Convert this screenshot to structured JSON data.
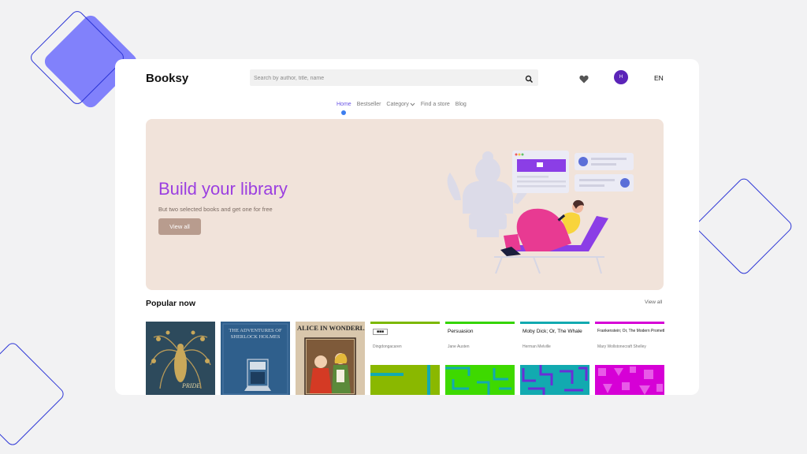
{
  "app": {
    "logo": "Booksy",
    "search_placeholder": "Search by author, title, name",
    "avatar_initial": "H",
    "language": "EN"
  },
  "nav": {
    "items": [
      {
        "label": "Home",
        "active": true
      },
      {
        "label": "Bestseller",
        "active": false
      },
      {
        "label": "Category",
        "active": false,
        "dropdown": true
      },
      {
        "label": "Find a store",
        "active": false
      },
      {
        "label": "Blog",
        "active": false
      }
    ]
  },
  "hero": {
    "title": "Build your library",
    "subtitle": "But two selected books and get one for free",
    "button": "View all"
  },
  "popular": {
    "title": "Popular now",
    "link": "View all",
    "books": [
      {
        "title": "Pride",
        "cover_text": "PRIDE"
      },
      {
        "title": "The Adventures of Sherlock Holmes",
        "cover_text": "THE ADVENTURES OF SHERLOCK HOLMES"
      },
      {
        "title": "Alice in Wonderland",
        "cover_text": "ALICE IN WONDERLAND"
      },
      {
        "title": "",
        "author": "Dingdongacaren",
        "accent": "#7cb800"
      },
      {
        "title": "Persuasion",
        "author": "Jane Austen",
        "accent": "#34d400"
      },
      {
        "title": "Moby Dick; Or, The Whale",
        "author": "Herman Melville",
        "accent": "#12aab0"
      },
      {
        "title": "Frankenstein; Or, The Modern Prometheus",
        "author": "Mary Wollstonecraft Shelley",
        "accent": "#d600d6"
      }
    ]
  },
  "colors": {
    "accent": "#9b3fe0",
    "avatar": "#5b24b8",
    "hero_bg": "#f1e3da",
    "hero_button": "#b89c8e"
  },
  "icons": [
    "search-icon",
    "heart-icon",
    "chevron-down-icon"
  ]
}
